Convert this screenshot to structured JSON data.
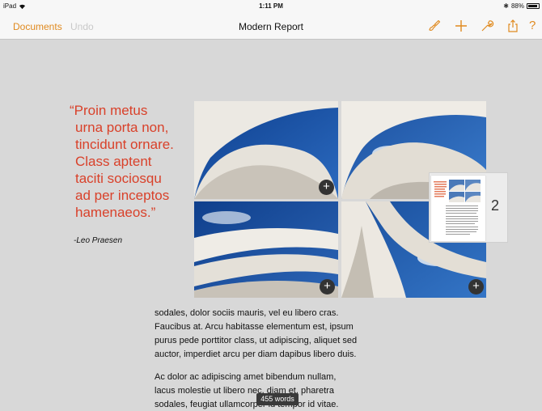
{
  "status_bar": {
    "device": "iPad",
    "time": "1:11 PM",
    "battery": "88%",
    "battery_level": 0.88
  },
  "toolbar": {
    "documents_label": "Documents",
    "undo_label": "Undo",
    "title": "Modern Report",
    "icons": [
      "paintbrush-icon",
      "plus-icon",
      "wrench-icon",
      "share-icon",
      "help-icon"
    ],
    "help_glyph": "?",
    "accent": "#e08a1f"
  },
  "quote": {
    "lines": [
      "“Proin metus",
      "urna porta non,",
      "tincidunt ornare.",
      "Class aptent",
      "taciti sociosqu",
      "ad per inceptos",
      "hamenaeos.”"
    ],
    "author": "-Leo Praesen",
    "color": "#d9412a"
  },
  "photo_grid": {
    "add_glyph": "+"
  },
  "body": {
    "paragraph1": [
      "sodales, dolor sociis mauris, vel eu libero cras.",
      "Faucibus at. Arcu habitasse elementum est, ipsum",
      "purus pede porttitor class, ut adipiscing, aliquet sed",
      "auctor, imperdiet arcu per diam dapibus libero duis."
    ],
    "paragraph2": [
      "Ac dolor ac adipiscing amet bibendum nullam,",
      "lacus molestie ut libero nec, diam et, pharetra",
      "sodales, feugiat ullamcorper id tempor id vitae."
    ]
  },
  "page_navigator": {
    "page_number": "2"
  },
  "word_count": "455 words"
}
